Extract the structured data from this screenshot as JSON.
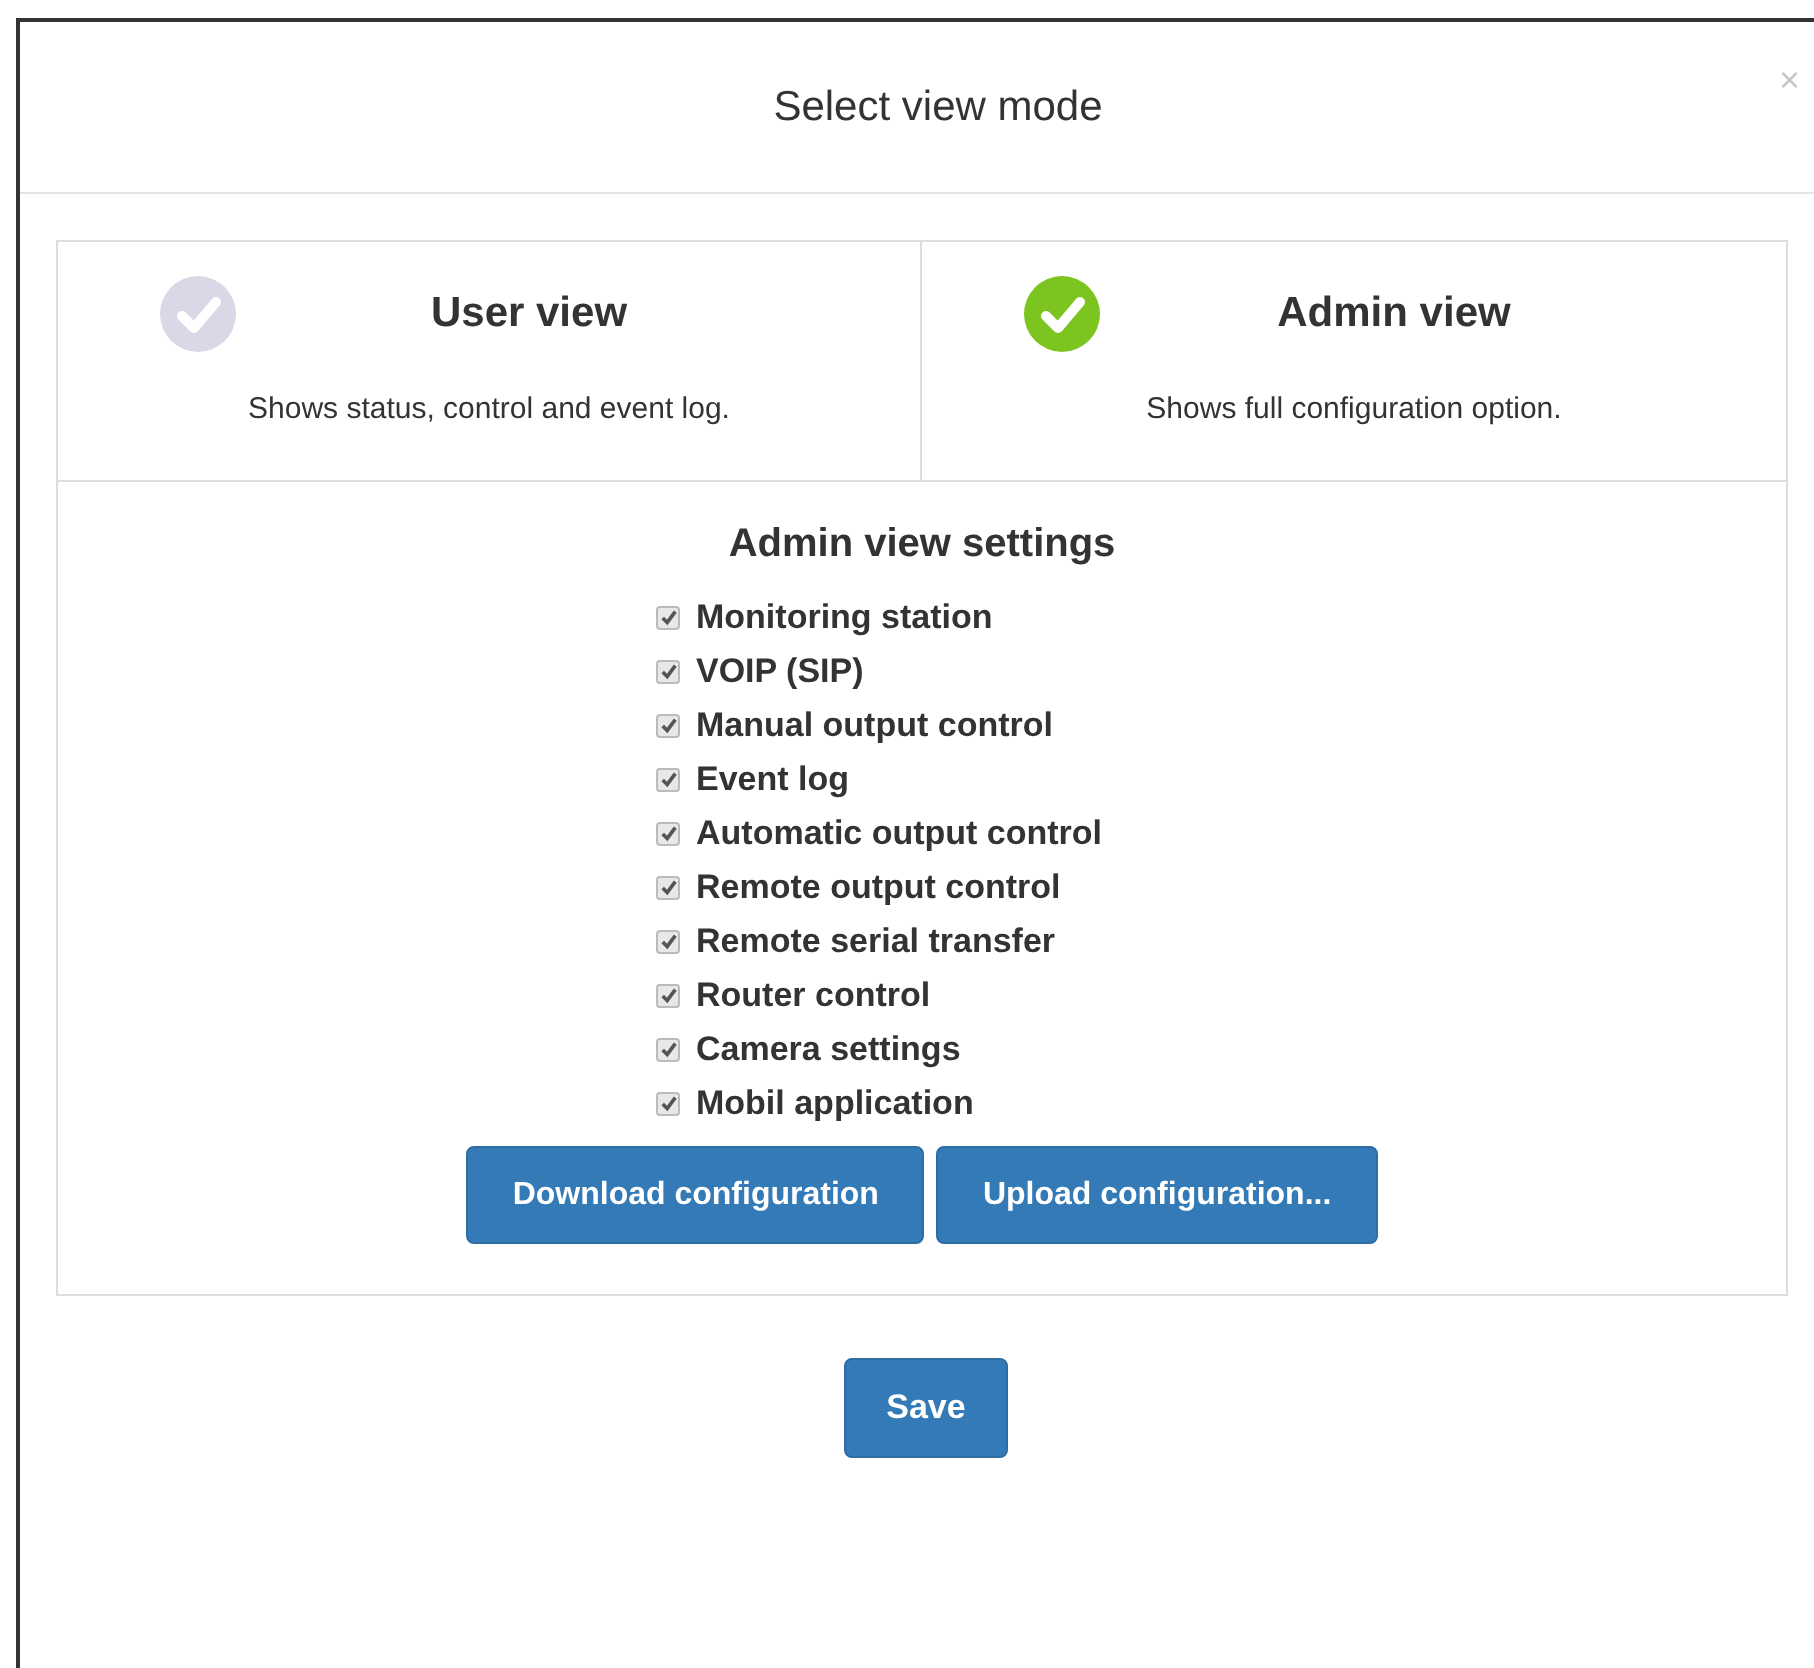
{
  "dialog": {
    "title": "Select view mode",
    "close": "×"
  },
  "modes": [
    {
      "title": "User view",
      "description": "Shows status, control and event log.",
      "selected": false
    },
    {
      "title": "Admin view",
      "description": "Shows full configuration option.",
      "selected": true
    }
  ],
  "settings": {
    "title": "Admin view settings",
    "options": [
      {
        "label": "Monitoring station",
        "checked": true
      },
      {
        "label": "VOIP (SIP)",
        "checked": true
      },
      {
        "label": "Manual output control",
        "checked": true
      },
      {
        "label": "Event log",
        "checked": true
      },
      {
        "label": "Automatic output control",
        "checked": true
      },
      {
        "label": "Remote output control",
        "checked": true
      },
      {
        "label": "Remote serial transfer",
        "checked": true
      },
      {
        "label": "Router control",
        "checked": true
      },
      {
        "label": "Camera settings",
        "checked": true
      },
      {
        "label": "Mobil application",
        "checked": true
      }
    ],
    "buttons": [
      "Download configuration",
      "Upload configuration..."
    ]
  },
  "footer": {
    "button": "Save"
  }
}
